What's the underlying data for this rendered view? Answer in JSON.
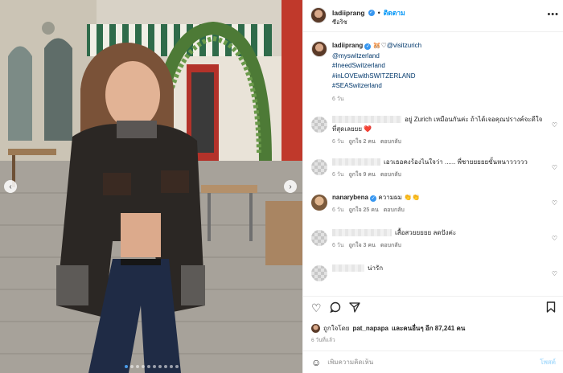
{
  "header": {
    "username": "ladiiprang",
    "follow_label": "ติดตาม",
    "separator": "•",
    "location": "ซือริช",
    "more_icon": "more-horizontal-icon"
  },
  "caption": {
    "username": "ladiiprang",
    "mention": "@visitzurich",
    "emoji_prefix": "🐹♡",
    "lines": [
      "@myswitzerland",
      "#IneedSwitzerland",
      "#inLOVEwithSWITZERLAND",
      "#SEASwitzerland"
    ],
    "time": "6 วัน"
  },
  "comments": [
    {
      "text": "อยู่ Zurich เหมือนกันค่ะ ถ้าได้เจอคุณปรางค์จะดีใจที่สุดเลยยย ❤️",
      "time": "6 วัน",
      "likes": "ถูกใจ 2 คน",
      "reply": "ตอบกลับ",
      "blurred": true
    },
    {
      "text": "เอวเธอคงร้องไนใจว่า ...... พี่ชายยยยยขั้นหนาววววว",
      "time": "6 วัน",
      "likes": "ถูกใจ 9 คน",
      "reply": "ตอบกลับ",
      "blurred": true
    },
    {
      "username": "nanarybena",
      "text": "ความผม 👏👏",
      "time": "6 วัน",
      "likes": "ถูกใจ 25 คน",
      "reply": "ตอบกลับ",
      "blurred": false
    },
    {
      "text": "เสื้อสวยยยยย ลดปังค่ะ",
      "time": "6 วัน",
      "likes": "ถูกใจ 3 คน",
      "reply": "ตอบกลับ",
      "blurred": true
    },
    {
      "text": "น่ารัก",
      "time": "",
      "likes": "",
      "reply": "",
      "blurred": true
    }
  ],
  "actions": {
    "like_icon": "heart-icon",
    "comment_icon": "comment-icon",
    "share_icon": "share-icon",
    "save_icon": "bookmark-icon"
  },
  "likes": {
    "prefix": "ถูกใจโดย",
    "liker": "pat_napapa",
    "suffix": "และคนอื่นๆ อีก 87,241 คน"
  },
  "posted_time": "6 วันที่แล้ว",
  "add_comment": {
    "placeholder": "เพิ่มความคิดเห็น",
    "post_label": "โพสต์"
  },
  "carousel": {
    "slide_count": 10,
    "active_index": 0
  },
  "colors": {
    "accent": "#0095f6",
    "link": "#00376b",
    "verified": "#3897f0",
    "muted": "#8e8e8e"
  }
}
